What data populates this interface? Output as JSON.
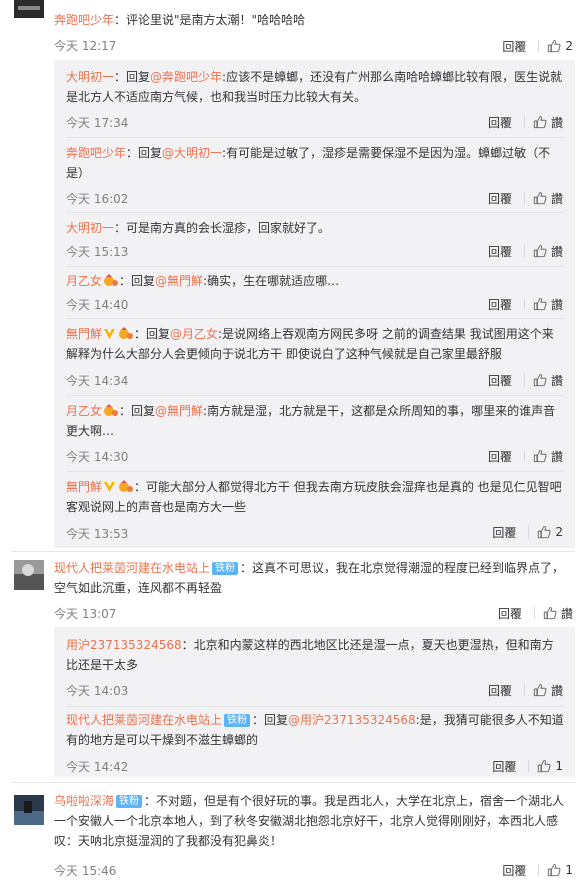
{
  "common": {
    "reply": "回覆",
    "praise": "讚"
  },
  "c1": {
    "user": "奔跑吧少年",
    "colon": "：",
    "text": "评论里说\"是南方太潮！\"哈哈哈哈",
    "time": "今天 12:17",
    "likes": "2",
    "replies": [
      {
        "user": "大明初一",
        "pre": "：回复",
        "at": "@奔跑吧少年",
        "text": ":应该不是蟑螂，还没有广州那么南哈哈蟑螂比较有限，医生说就是北方人不适应南方气候，也和我当时压力比较大有关。",
        "time": "今天 17:34"
      },
      {
        "user": "奔跑吧少年",
        "pre": "：回复",
        "at": "@大明初一",
        "text": ":有可能是过敏了，湿疹是需要保湿不是因为湿。蟑螂过敏（不是）",
        "time": "今天 16:02"
      },
      {
        "user": "大明初一",
        "pre": "：",
        "at": "",
        "text": "可是南方真的会长湿疹，回家就好了。",
        "time": "今天 15:13"
      },
      {
        "user": "月乙女",
        "pre": "：回复",
        "at": "@無門鮮",
        "text": ":确实，生在哪就适应哪…",
        "time": "今天 14:40"
      },
      {
        "user": "無門鮮",
        "pre": "：回复",
        "at": "@月乙女",
        "text": ":是说网络上吞观南方网民多呀 之前的调查结果 我试图用这个来解释为什么大部分人会更倾向于说北方干 即使说白了这种气候就是自己家里最舒服",
        "time": "今天 14:34"
      },
      {
        "user": "月乙女",
        "pre": "：回复",
        "at": "@無門鮮",
        "text": ":南方就是湿，北方就是干，这都是众所周知的事，哪里来的谁声音更大啊…",
        "time": "今天 14:30"
      },
      {
        "user": "無門鮮",
        "pre": "：",
        "at": "",
        "text": "可能大部分人都觉得北方干 但我去南方玩皮肤会湿痒也是真的 也是见仁见智吧 客观说网上的声音也是南方大一些",
        "time": "今天 13:53",
        "likes": "2"
      }
    ]
  },
  "c2": {
    "user": "现代人把莱茵河建在水电站上",
    "badge": "铁粉",
    "colon": "：",
    "text": "这真不可思议，我在北京觉得潮湿的程度已经到临界点了，空气如此沉重，连风都不再轻盈",
    "time": "今天 13:07",
    "replies": [
      {
        "user": "用沪237135324568",
        "pre": "：",
        "at": "",
        "text": "北京和内蒙这样的西北地区比还是湿一点，夏天也更湿热，但和南方比还是干太多",
        "time": "今天 14:03"
      },
      {
        "user": "现代人把莱茵河建在水电站上",
        "badge": "铁粉",
        "pre": "：回复",
        "at": "@用沪237135324568",
        "text": ":是，我猜可能很多人不知道有的地方是可以干燥到不滋生蟑螂的",
        "time": "今天 14:42",
        "likes": "1"
      }
    ]
  },
  "c3": {
    "user": "乌啦啦深海",
    "badge": "铁粉",
    "colon": "：",
    "text": "不对题，但是有个很好玩的事。我是西北人，大学在北京上，宿舍一个湖北人一个安徽人一个北京本地人，到了秋冬安徽湖北抱怨北京好干，北京人觉得刚刚好，本西北人感叹：天呐北京挺湿润的了我都没有犯鼻炎！",
    "time": "今天 15:46",
    "likes": "1"
  },
  "colors": {
    "username": "#eb7350",
    "subBg": "#f2f2f5",
    "badge": "#5eb3f5"
  },
  "icons": [
    "thumbs-up-icon",
    "vip-v-icon",
    "medal-icon",
    "avatar"
  ]
}
